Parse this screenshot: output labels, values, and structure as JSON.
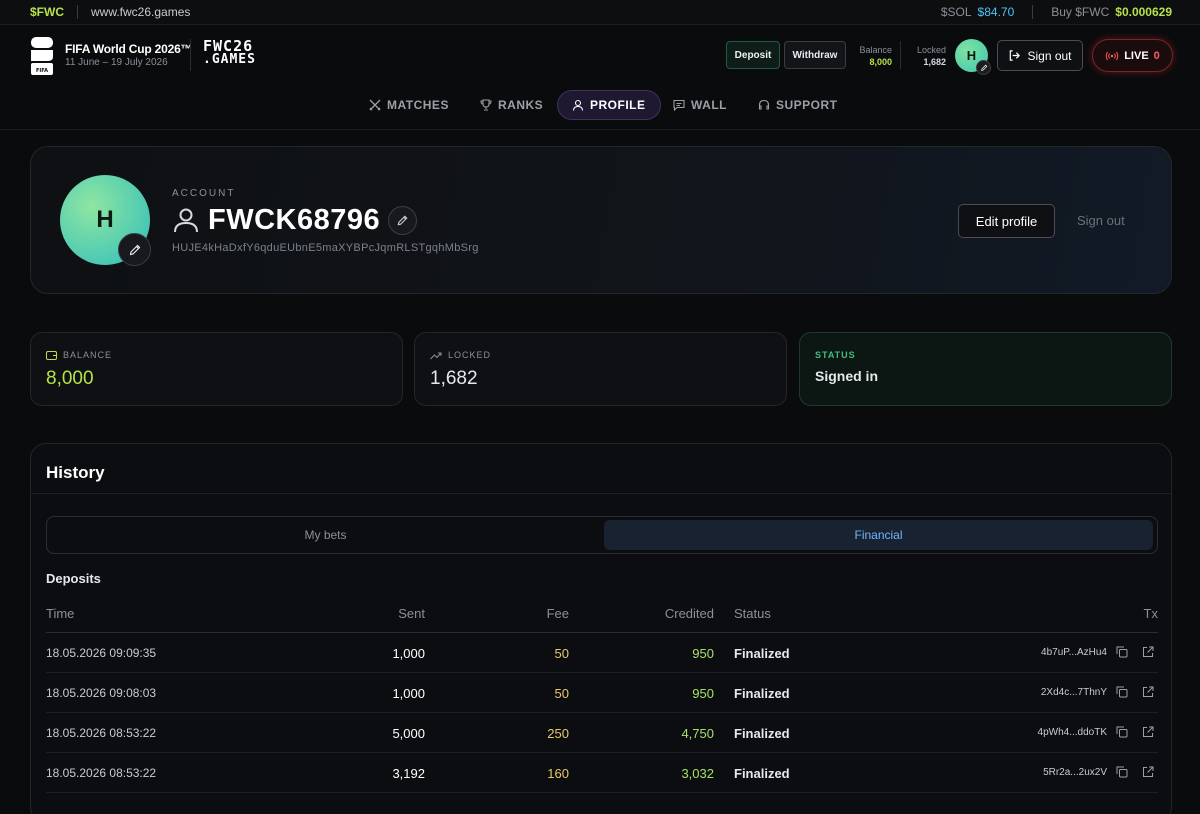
{
  "ticker": {
    "token": "$FWC",
    "url": "www.fwc26.games",
    "sol_label": "$SOL",
    "sol_price": "$84.70",
    "buy_label": "Buy $FWC",
    "buy_price": "$0.000629"
  },
  "header": {
    "event_title": "FIFA World Cup 2026™",
    "event_dates": "11 June – 19 July 2026",
    "fifa_mark": "FIFA",
    "brand_line1": "FWC26",
    "brand_line2": ".GAMES",
    "deposit_label": "Deposit",
    "withdraw_label": "Withdraw",
    "balance_label": "Balance",
    "balance_value": "8,000",
    "locked_label": "Locked",
    "locked_value": "1,682",
    "avatar_initial": "H",
    "signout_label": "Sign out",
    "live_label": "LIVE",
    "live_count": "0"
  },
  "nav": {
    "items": [
      {
        "label": "MATCHES",
        "icon": "crossed-swords-icon"
      },
      {
        "label": "RANKS",
        "icon": "trophy-icon"
      },
      {
        "label": "PROFILE",
        "icon": "user-icon",
        "active": true
      },
      {
        "label": "WALL",
        "icon": "chat-icon"
      },
      {
        "label": "SUPPORT",
        "icon": "headset-icon"
      }
    ]
  },
  "profile": {
    "avatar_initial": "H",
    "section_label": "ACCOUNT",
    "username": "FWCK68796",
    "wallet": "HUJE4kHaDxfY6qduEUbnE5maXYBPcJqmRLSTgqhMbSrg",
    "edit_profile_label": "Edit profile",
    "signout_label": "Sign out"
  },
  "stats": {
    "balance_label": "BALANCE",
    "balance_value": "8,000",
    "locked_label": "LOCKED",
    "locked_value": "1,682",
    "status_label": "STATUS",
    "status_value": "Signed in"
  },
  "history": {
    "title": "History",
    "tabs": [
      {
        "label": "My bets"
      },
      {
        "label": "Financial",
        "active": true
      }
    ],
    "deposits_title": "Deposits",
    "columns": {
      "time": "Time",
      "sent": "Sent",
      "fee": "Fee",
      "credited": "Credited",
      "status": "Status",
      "tx": "Tx"
    },
    "rows": [
      {
        "time": "18.05.2026 09:09:35",
        "sent": "1,000",
        "fee": "50",
        "credited": "950",
        "status": "Finalized",
        "tx": "4b7uP...AzHu4"
      },
      {
        "time": "18.05.2026 09:08:03",
        "sent": "1,000",
        "fee": "50",
        "credited": "950",
        "status": "Finalized",
        "tx": "2Xd4c...7ThnY"
      },
      {
        "time": "18.05.2026 08:53:22",
        "sent": "5,000",
        "fee": "250",
        "credited": "4,750",
        "status": "Finalized",
        "tx": "4pWh4...ddoTK"
      },
      {
        "time": "18.05.2026 08:53:22",
        "sent": "3,192",
        "fee": "160",
        "credited": "3,032",
        "status": "Finalized",
        "tx": "5Rr2a...2ux2V"
      }
    ]
  },
  "colors": {
    "accent_green": "#b6e24a",
    "sol_blue": "#4fc3f7",
    "live_red": "#ff5b5b",
    "fee_yellow": "#e8c86a",
    "financial_blue": "#6fb6ff",
    "status_green": "#3fbf7f"
  }
}
